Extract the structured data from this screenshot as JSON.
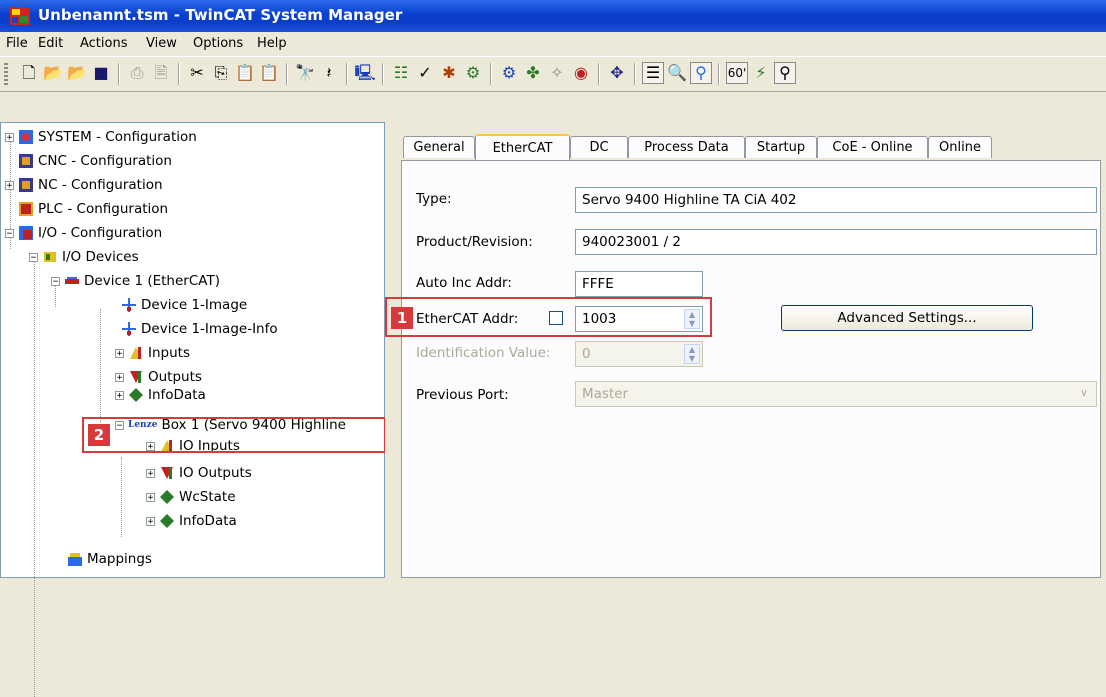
{
  "window": {
    "title": "Unbenannt.tsm - TwinCAT System Manager"
  },
  "menu": {
    "items": [
      {
        "label": "File"
      },
      {
        "label": "Edit"
      },
      {
        "label": "Actions"
      },
      {
        "label": "View"
      },
      {
        "label": "Options"
      },
      {
        "label": "Help"
      }
    ]
  },
  "tree": {
    "items": [
      {
        "label": "SYSTEM - Configuration"
      },
      {
        "label": "CNC - Configuration"
      },
      {
        "label": "NC - Configuration"
      },
      {
        "label": "PLC - Configuration"
      },
      {
        "label": "I/O - Configuration"
      },
      {
        "label": "I/O Devices"
      },
      {
        "label": "Device 1 (EtherCAT)"
      },
      {
        "label": "Device 1-Image"
      },
      {
        "label": "Device 1-Image-Info"
      },
      {
        "label": "Inputs"
      },
      {
        "label": "Outputs"
      },
      {
        "label": "InfoData"
      },
      {
        "label": "Box 1 (Servo 9400 Highline"
      },
      {
        "label": "IO Inputs"
      },
      {
        "label": "IO Outputs"
      },
      {
        "label": "WcState"
      },
      {
        "label": "InfoData"
      },
      {
        "label": "Mappings"
      }
    ],
    "box_prefix": "Lenze"
  },
  "tabs": [
    {
      "label": "General"
    },
    {
      "label": "EtherCAT"
    },
    {
      "label": "DC"
    },
    {
      "label": "Process Data"
    },
    {
      "label": "Startup"
    },
    {
      "label": "CoE - Online"
    },
    {
      "label": "Online"
    }
  ],
  "form": {
    "type_label": "Type:",
    "type_value": "Servo 9400 Highline TA CiA 402",
    "product_label": "Product/Revision:",
    "product_value": "940023001 / 2",
    "autoinc_label": "Auto Inc Addr:",
    "autoinc_value": "FFFE",
    "ecaddr_label": "EtherCAT Addr:",
    "ecaddr_value": "1003",
    "ident_label": "Identification Value:",
    "ident_value": "0",
    "prevport_label": "Previous Port:",
    "prevport_value": "Master",
    "advanced_button": "Advanced Settings..."
  },
  "markers": {
    "m1": "1",
    "m2": "2"
  },
  "colors": {
    "title_bar": "#0b3dc7",
    "highlight": "#d73a3a",
    "active_tab": "#ffc73c"
  }
}
